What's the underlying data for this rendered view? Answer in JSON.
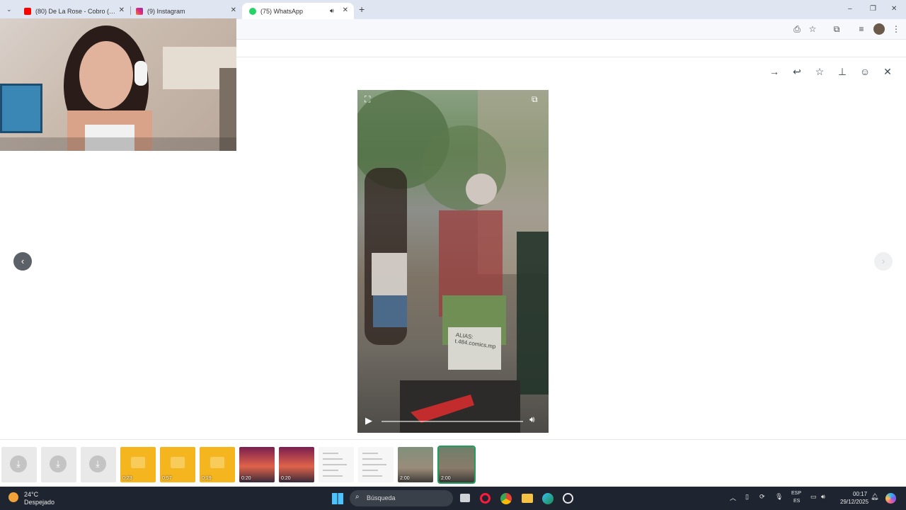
{
  "browser": {
    "tabs": [
      {
        "title": "(80) De La Rose - Cobro (Offici",
        "icon": "youtube-icon",
        "color": "#ff0000"
      },
      {
        "title": "(9) Instagram",
        "icon": "instagram-icon",
        "color": "#d6249f"
      },
      {
        "title": "(75) WhatsApp",
        "icon": "whatsapp-icon",
        "color": "#25d366",
        "badge": "75"
      }
    ],
    "new_tab": "+",
    "window_controls": {
      "minimize": "–",
      "maximize": "❐",
      "close": "✕"
    }
  },
  "viewer": {
    "video": {
      "alias_text": "ALIAS:\nt.484.comics.mp"
    },
    "nav": {
      "prev": "‹",
      "next": "›"
    }
  },
  "thumbnails": [
    {
      "type": "download",
      "duration": ""
    },
    {
      "type": "download",
      "duration": ""
    },
    {
      "type": "download",
      "duration": ""
    },
    {
      "type": "audio",
      "duration": "0:23"
    },
    {
      "type": "audio",
      "duration": "0:57"
    },
    {
      "type": "audio",
      "duration": "0:19"
    },
    {
      "type": "video",
      "duration": "0:20"
    },
    {
      "type": "video",
      "duration": "0:20"
    },
    {
      "type": "doc",
      "duration": ""
    },
    {
      "type": "doc",
      "duration": ""
    },
    {
      "type": "video",
      "duration": "2:00"
    },
    {
      "type": "video-selected",
      "duration": "2:00"
    }
  ],
  "taskbar": {
    "weather_temp": "24°C",
    "weather_desc": "Despejado",
    "search_placeholder": "Búsqueda",
    "lang_top": "ESP",
    "lang_bottom": "ES",
    "time": "00:17",
    "date": "29/12/2025"
  }
}
